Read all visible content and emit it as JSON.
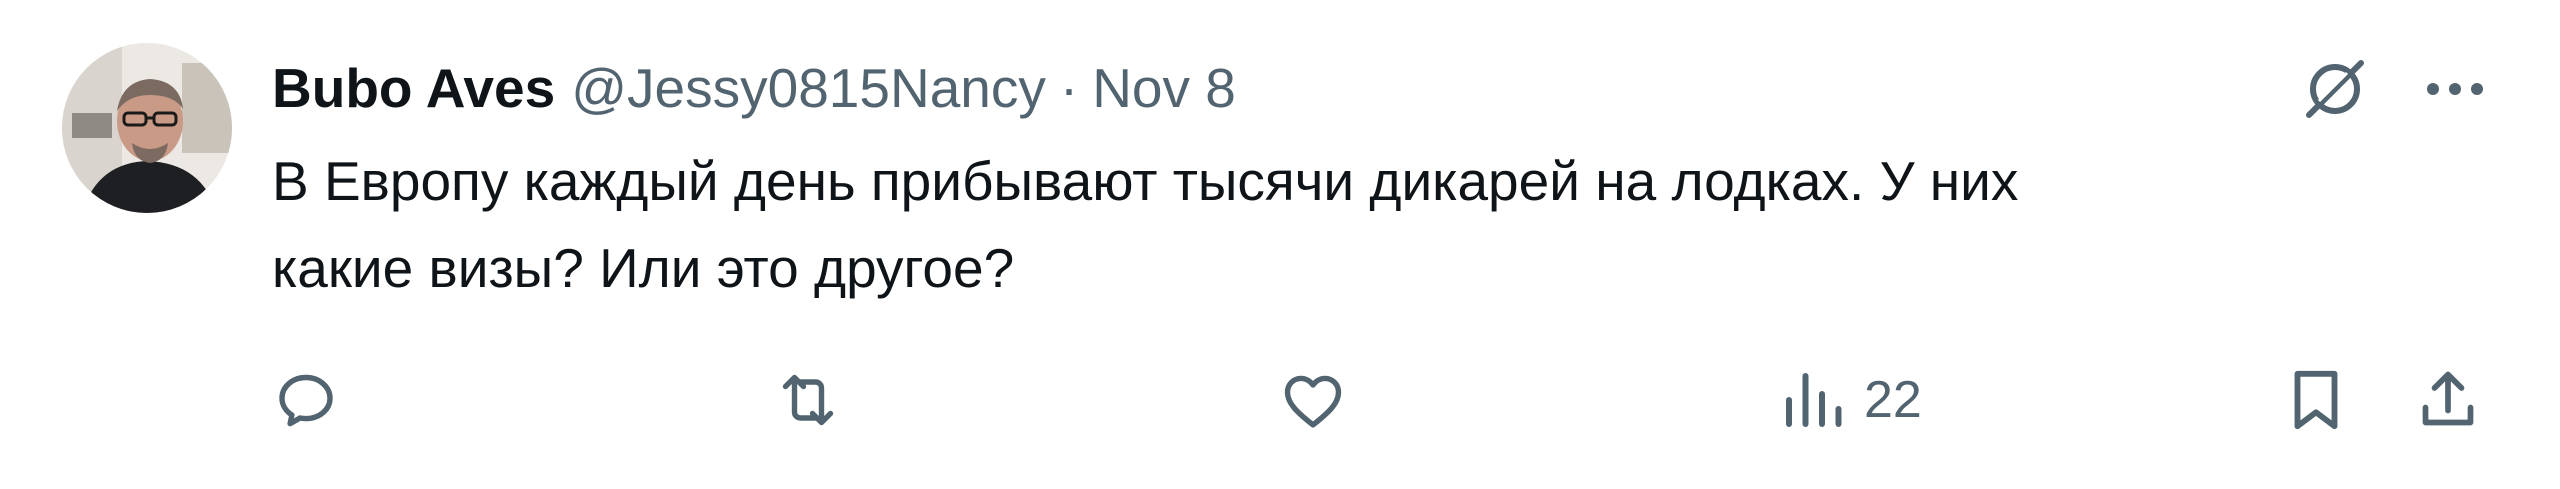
{
  "tweet": {
    "display_name": "Bubo Aves",
    "handle": "@Jessy0815Nancy",
    "separator": "·",
    "timestamp": "Nov 8",
    "text": "В Европу каждый день прибывают тысячи дикарей на лодках. У них\nкакие визы? Или это другое?"
  },
  "actions": {
    "reply_count": "",
    "retweet_count": "",
    "like_count": "",
    "views_count": "22"
  },
  "icons": {
    "grok": "grok-icon",
    "more": "more-horizontal-icon",
    "reply": "reply-icon",
    "retweet": "retweet-icon",
    "like": "heart-icon",
    "views": "analytics-icon",
    "bookmark": "bookmark-icon",
    "share": "share-icon"
  },
  "colors": {
    "text_primary": "#0f1419",
    "text_secondary": "#536471"
  }
}
